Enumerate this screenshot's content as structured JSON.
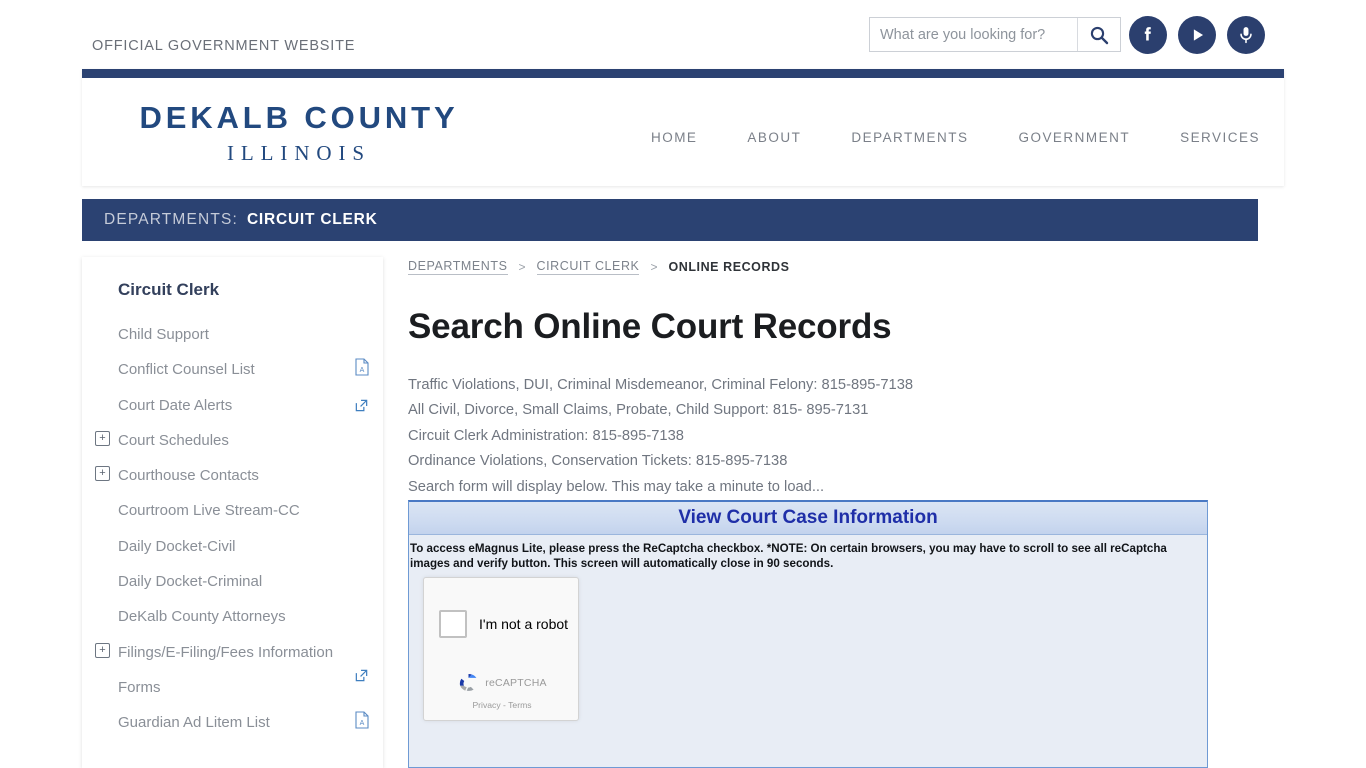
{
  "topbar": {
    "official_text": "OFFICIAL GOVERNMENT WEBSITE",
    "search_placeholder": "What are you looking for?",
    "search_value": "",
    "search_button_label": "Search",
    "socials": [
      {
        "name": "facebook",
        "label": "Facebook"
      },
      {
        "name": "youtube",
        "label": "YouTube"
      },
      {
        "name": "podcast",
        "label": "Podcast"
      }
    ]
  },
  "header": {
    "logo_main": "DEKALB COUNTY",
    "logo_sub": "ILLINOIS",
    "nav": [
      {
        "label": "HOME"
      },
      {
        "label": "ABOUT"
      },
      {
        "label": "DEPARTMENTS"
      },
      {
        "label": "GOVERNMENT"
      },
      {
        "label": "SERVICES"
      }
    ]
  },
  "dept_banner": {
    "label": "DEPARTMENTS:",
    "name": "CIRCUIT CLERK"
  },
  "sidebar": {
    "title": "Circuit Clerk",
    "items": [
      {
        "label": "Child Support",
        "expander": false,
        "icon": ""
      },
      {
        "label": "Conflict Counsel List",
        "expander": false,
        "icon": "pdf-icon"
      },
      {
        "label": "Court Date Alerts",
        "expander": false,
        "icon": "external-link-icon"
      },
      {
        "label": "Court Schedules",
        "expander": true,
        "icon": ""
      },
      {
        "label": "Courthouse Contacts",
        "expander": true,
        "icon": ""
      },
      {
        "label": "Courtroom Live Stream-CC",
        "expander": false,
        "icon": ""
      },
      {
        "label": "Daily Docket-Civil",
        "expander": false,
        "icon": ""
      },
      {
        "label": "Daily Docket-Criminal",
        "expander": false,
        "icon": ""
      },
      {
        "label": "DeKalb County Attorneys",
        "expander": false,
        "icon": ""
      },
      {
        "label": "Filings/E-Filing/Fees Information",
        "expander": true,
        "icon": "external-link-icon"
      },
      {
        "label": "Forms",
        "expander": false,
        "icon": ""
      },
      {
        "label": "Guardian Ad Litem List",
        "expander": false,
        "icon": "pdf-icon"
      }
    ]
  },
  "breadcrumb": {
    "items": [
      {
        "label": "DEPARTMENTS",
        "current": false
      },
      {
        "label": "CIRCUIT CLERK",
        "current": false
      },
      {
        "label": "ONLINE RECORDS",
        "current": true
      }
    ],
    "separator": ">"
  },
  "main": {
    "title": "Search Online Court Records",
    "paragraphs": [
      "Traffic Violations, DUI, Criminal Misdemeanor, Criminal Felony: 815-895-7138",
      "All Civil, Divorce, Small Claims, Probate, Child Support: 815- 895-7131",
      "Circuit Clerk Administration: 815-895-7138",
      "Ordinance Violations, Conservation Tickets: 815-895-7138",
      "Search form will display below.  This may take a minute to load..."
    ]
  },
  "panel": {
    "title": "View Court Case Information",
    "note": "To access eMagnus Lite, please press the ReCaptcha checkbox. *NOTE: On certain browsers, you may have to scroll to see all reCaptcha images and verify button. This screen will automatically close in 90 seconds.",
    "recaptcha": {
      "checkbox_label": "I'm not a robot",
      "brand": "reCAPTCHA",
      "privacy": "Privacy",
      "legal_separator": "-",
      "terms": "Terms",
      "checked": false
    }
  },
  "colors": {
    "navy": "#2b4272",
    "logo_blue": "#22497f",
    "panel_bg": "#e8edf5",
    "panel_border": "#6f9ad4",
    "panel_title": "#1f2fa8",
    "social_bg": "#2b3f6e"
  }
}
